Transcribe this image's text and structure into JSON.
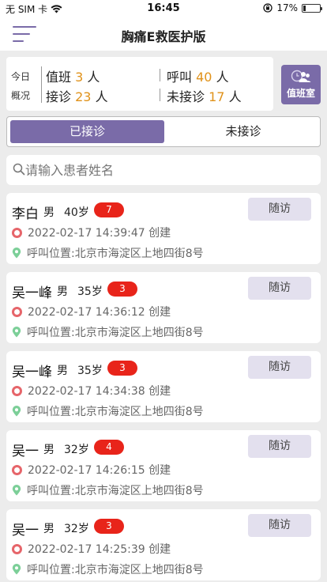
{
  "status_bar": {
    "carrier": "无 SIM 卡",
    "time": "16:45",
    "battery": "17%",
    "battery_level": 0.17
  },
  "header": {
    "title": "胸痛E救医护版"
  },
  "summary": {
    "label_line1": "今日",
    "label_line2": "概况",
    "on_duty": {
      "label": "值班",
      "value": "3",
      "unit": "人"
    },
    "calls": {
      "label": "呼叫",
      "value": "40",
      "unit": "人"
    },
    "received": {
      "label": "接诊",
      "value": "23",
      "unit": "人"
    },
    "not_received": {
      "label": "未接诊",
      "value": "17",
      "unit": "人"
    }
  },
  "duty_room": {
    "label": "值班室"
  },
  "tabs": [
    {
      "label": "已接诊",
      "active": true
    },
    {
      "label": "未接诊",
      "active": false
    }
  ],
  "search": {
    "placeholder": "请输入患者姓名",
    "value": ""
  },
  "colors": {
    "accent": "#7a6ba8",
    "badge": "#e8241a",
    "highlight": "#e0921a"
  },
  "patients": [
    {
      "name": "李白",
      "gender": "男",
      "age": "40岁",
      "badge": "7",
      "time": "2022-02-17 14:39:47 创建",
      "location": "呼叫位置:北京市海淀区上地四街8号",
      "action": "随访"
    },
    {
      "name": "吴一峰",
      "gender": "男",
      "age": "35岁",
      "badge": "3",
      "time": "2022-02-17 14:36:12 创建",
      "location": "呼叫位置:北京市海淀区上地四街8号",
      "action": "随访"
    },
    {
      "name": "吴一峰",
      "gender": "男",
      "age": "35岁",
      "badge": "3",
      "time": "2022-02-17 14:34:38 创建",
      "location": "呼叫位置:北京市海淀区上地四街8号",
      "action": "随访"
    },
    {
      "name": "吴一",
      "gender": "男",
      "age": "32岁",
      "badge": "4",
      "time": "2022-02-17 14:26:15 创建",
      "location": "呼叫位置:北京市海淀区上地四街8号",
      "action": "随访"
    },
    {
      "name": "吴一",
      "gender": "男",
      "age": "32岁",
      "badge": "3",
      "time": "2022-02-17 14:25:39 创建",
      "location": "呼叫位置:北京市海淀区上地四街8号",
      "action": "随访"
    }
  ]
}
